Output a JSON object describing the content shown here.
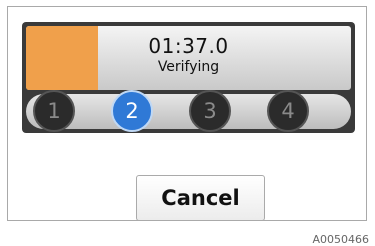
{
  "status": {
    "timer": "01:37.0",
    "message": "Verifying",
    "progress": 0.22,
    "progress_color": "#f0a04b"
  },
  "steps": {
    "items": [
      "1",
      "2",
      "3",
      "4"
    ],
    "active_index": 1,
    "active_color": "#2f79d6"
  },
  "actions": {
    "cancel_label": "Cancel"
  },
  "figure_id": "A0050466"
}
